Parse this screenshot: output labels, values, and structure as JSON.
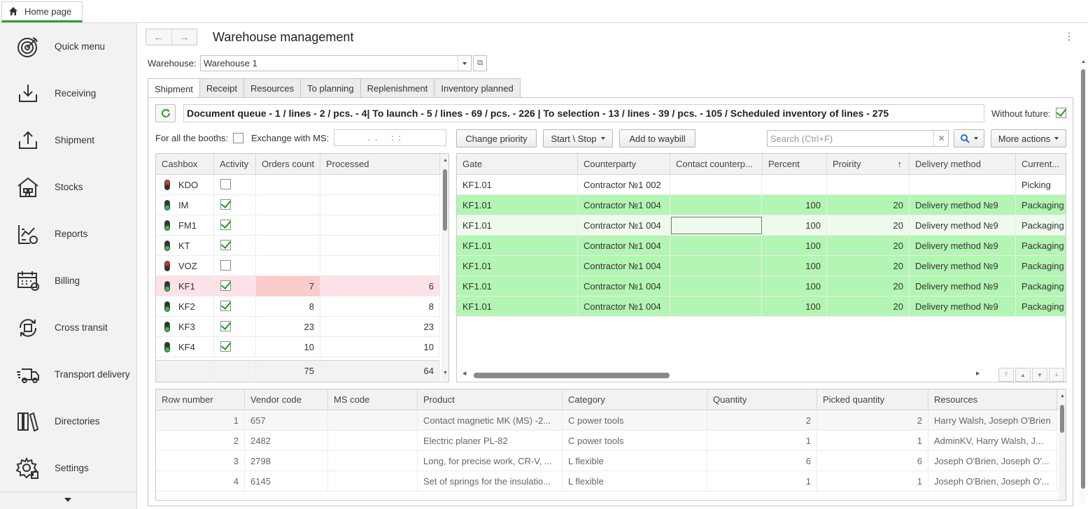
{
  "top_tab": {
    "label": "Home page",
    "icon": "home-icon"
  },
  "sidebar": {
    "items": [
      {
        "label": "Quick menu",
        "icon": "target-icon"
      },
      {
        "label": "Receiving",
        "icon": "receiving-icon"
      },
      {
        "label": "Shipment",
        "icon": "shipment-icon"
      },
      {
        "label": "Stocks",
        "icon": "warehouse-icon"
      },
      {
        "label": "Reports",
        "icon": "reports-icon"
      },
      {
        "label": "Billing",
        "icon": "calendar-icon"
      },
      {
        "label": "Cross transit",
        "icon": "cross-transit-icon"
      },
      {
        "label": "Transport delivery",
        "icon": "truck-icon"
      },
      {
        "label": "Directories",
        "icon": "books-icon"
      },
      {
        "label": "Settings",
        "icon": "gear-icon"
      }
    ]
  },
  "header": {
    "title": "Warehouse management"
  },
  "warehouse": {
    "label": "Warehouse:",
    "value": "Warehouse 1"
  },
  "tabs": [
    "Shipment",
    "Receipt",
    "Resources",
    "To planning",
    "Replenishment",
    "Inventory planned"
  ],
  "queue_text": "Document queue - 1 / lines - 2 / pcs. - 4| To launch  - 5 / lines - 69 / pcs. - 226 | To selection - 13 / lines - 39 / pcs. - 105 / Scheduled inventory of lines - 275",
  "without_future": {
    "label": "Without future:",
    "checked": true
  },
  "booths": {
    "label": "For all the booths:",
    "checked": false
  },
  "exchange": {
    "label": "Exchange with MS:",
    "value": ".  .      :  :"
  },
  "toolbar": {
    "change_priority": "Change priority",
    "start_stop": "Start \\ Stop",
    "add_to_waybill": "Add to waybill",
    "search_placeholder": "Search (Ctrl+F)",
    "more_actions": "More actions"
  },
  "cashbox_table": {
    "columns": [
      "Cashbox",
      "Activity",
      "Orders count",
      "Processed"
    ],
    "rows": [
      {
        "name": "KDO",
        "light": "red",
        "active": false,
        "orders": "",
        "processed": ""
      },
      {
        "name": "IM",
        "light": "green",
        "active": true,
        "orders": "",
        "processed": ""
      },
      {
        "name": "FM1",
        "light": "green",
        "active": true,
        "orders": "",
        "processed": ""
      },
      {
        "name": "KT",
        "light": "green",
        "active": true,
        "orders": "",
        "processed": ""
      },
      {
        "name": "VOZ",
        "light": "red",
        "active": false,
        "orders": "",
        "processed": ""
      },
      {
        "name": "KF1",
        "light": "green",
        "active": true,
        "orders": "7",
        "processed": "6"
      },
      {
        "name": "KF2",
        "light": "green",
        "active": true,
        "orders": "8",
        "processed": "8"
      },
      {
        "name": "KF3",
        "light": "green",
        "active": true,
        "orders": "23",
        "processed": "23"
      },
      {
        "name": "KF4",
        "light": "green",
        "active": true,
        "orders": "10",
        "processed": "10"
      }
    ],
    "footer": {
      "orders": "75",
      "processed": "64"
    }
  },
  "gate_table": {
    "columns": [
      "Gate",
      "Counterparty",
      "Contact counterp...",
      "Percent",
      "Proirity",
      "Delivery method",
      "Current..."
    ],
    "sort_icon": "↑",
    "rows": [
      {
        "gate": "KF1.01",
        "counterparty": "Contractor №1 002",
        "contact": "",
        "percent": "",
        "priority": "",
        "delivery": "",
        "current": "Picking",
        "style": "white"
      },
      {
        "gate": "KF1.01",
        "counterparty": "Contractor №1 004",
        "contact": "",
        "percent": "100",
        "priority": "20",
        "delivery": "Delivery method №9",
        "current": "Packaging",
        "style": "green"
      },
      {
        "gate": "KF1.01",
        "counterparty": "Contractor №1 004",
        "contact": "",
        "percent": "100",
        "priority": "20",
        "delivery": "Delivery method №9",
        "current": "Packaging",
        "style": "selected"
      },
      {
        "gate": "KF1.01",
        "counterparty": "Contractor №1 004",
        "contact": "",
        "percent": "100",
        "priority": "20",
        "delivery": "Delivery method №9",
        "current": "Packaging",
        "style": "green"
      },
      {
        "gate": "KF1.01",
        "counterparty": "Contractor №1 004",
        "contact": "",
        "percent": "100",
        "priority": "20",
        "delivery": "Delivery method №9",
        "current": "Packaging",
        "style": "green"
      },
      {
        "gate": "KF1.01",
        "counterparty": "Contractor №1 004",
        "contact": "",
        "percent": "100",
        "priority": "20",
        "delivery": "Delivery method №9",
        "current": "Packaging",
        "style": "green"
      },
      {
        "gate": "KF1.01",
        "counterparty": "Contractor №1 004",
        "contact": "",
        "percent": "100",
        "priority": "20",
        "delivery": "Delivery method №9",
        "current": "Packaging",
        "style": "green"
      }
    ]
  },
  "lines_table": {
    "columns": [
      "Row number",
      "Vendor code",
      "MS code",
      "Product",
      "Category",
      "Quantity",
      "Picked quantity",
      "Resources"
    ],
    "rows": [
      {
        "row": "1",
        "vendor": "657",
        "ms": "",
        "product": "Contact magnetic MK (MS) -2...",
        "category": "C power tools",
        "qty": "2",
        "picked": "2",
        "resources": "Harry Walsh, Joseph O'Brien"
      },
      {
        "row": "2",
        "vendor": "2482",
        "ms": "",
        "product": "Electric planer PL-82",
        "category": "C power tools",
        "qty": "1",
        "picked": "1",
        "resources": "AdminKV, Harry Walsh, J..."
      },
      {
        "row": "3",
        "vendor": "2798",
        "ms": "",
        "product": "Long, for precise work, CR-V, ...",
        "category": "L flexible",
        "qty": "6",
        "picked": "6",
        "resources": "Joseph O'Brien, Joseph O'..."
      },
      {
        "row": "4",
        "vendor": "6145",
        "ms": "",
        "product": "Set of springs for the insulatio...",
        "category": "L flexible",
        "qty": "1",
        "picked": "1",
        "resources": "Joseph O'Brien, Joseph O'..."
      }
    ]
  },
  "colors": {
    "row_green": "#b3f5b3",
    "row_pink": "#fde2e8",
    "accent_green": "#2e9f2e"
  }
}
